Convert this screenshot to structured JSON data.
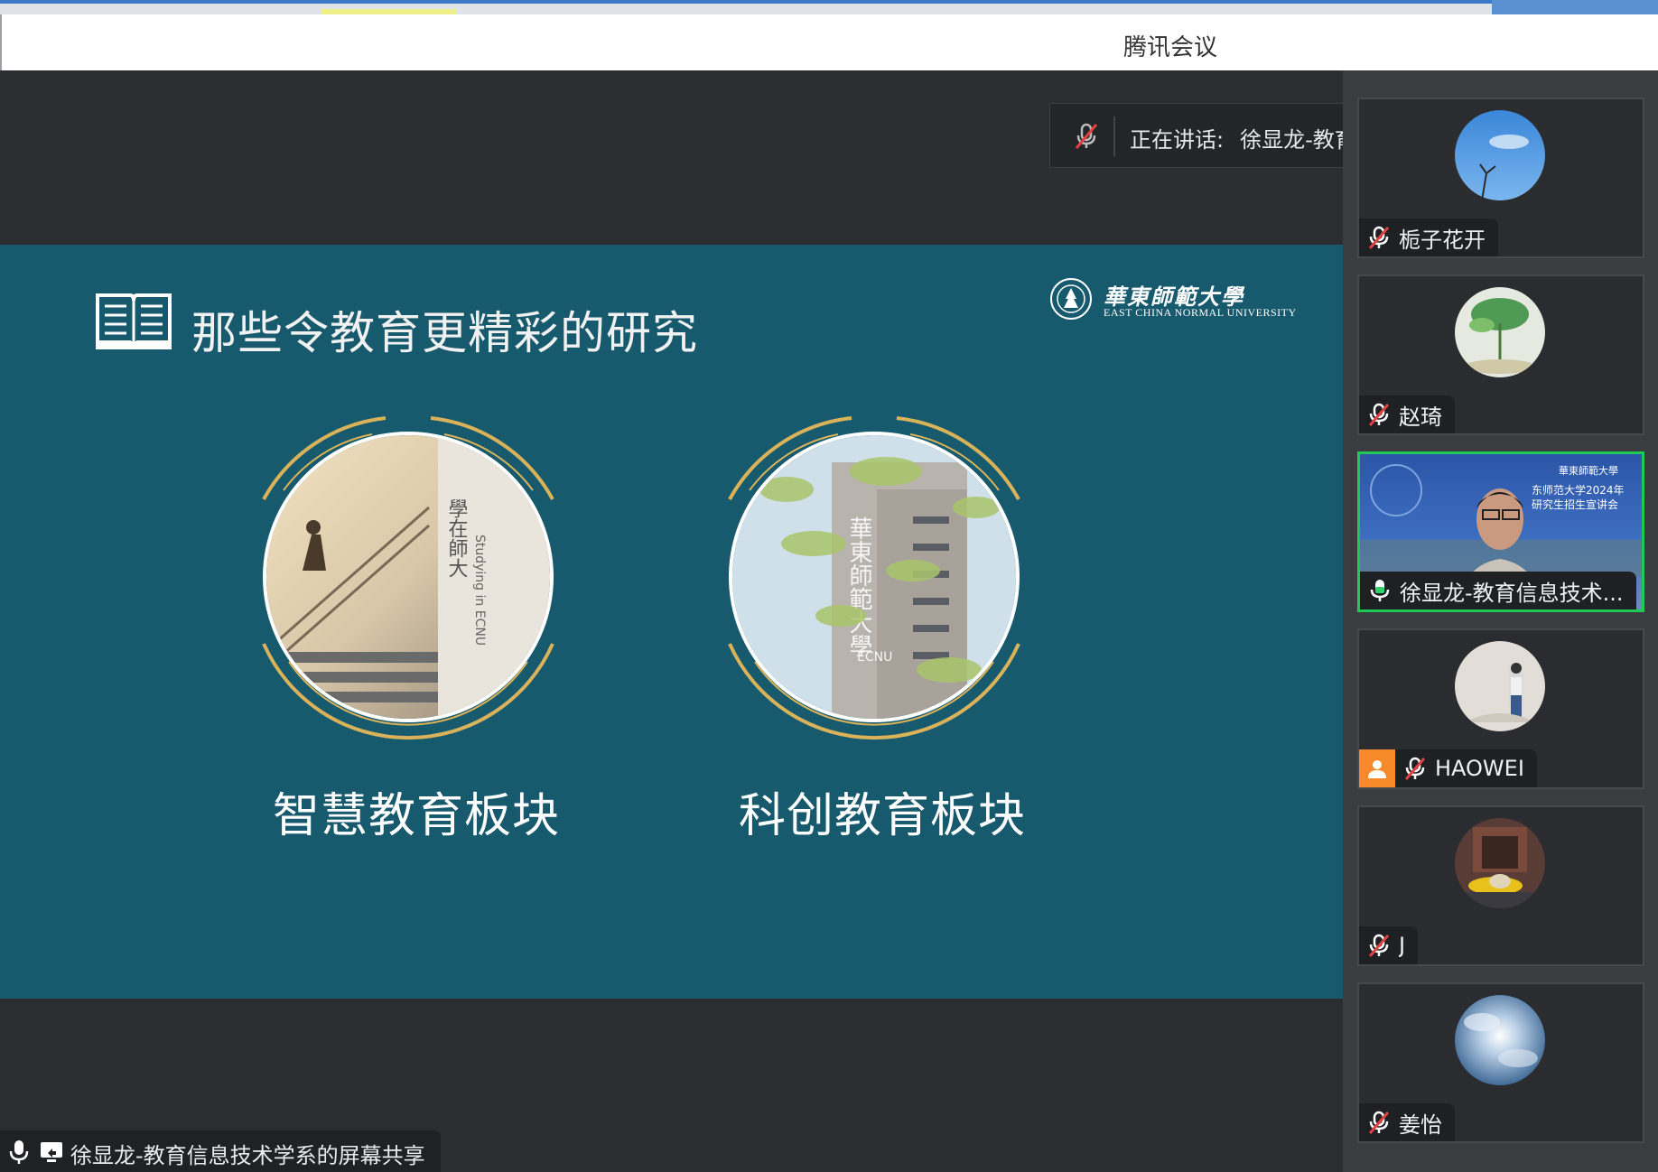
{
  "window": {
    "title": "腾讯会议"
  },
  "speaking": {
    "label": "正在讲话:",
    "name": "徐显龙-教育信息技..."
  },
  "slide": {
    "heading": "那些令教育更精彩的研究",
    "logo_cn": "華東師範大學",
    "logo_en": "EAST CHINA NORMAL UNIVERSITY",
    "modules": [
      {
        "label": "智慧教育板块",
        "photo_text_cn": "學在師大",
        "photo_text_en": "Studying in ECNU"
      },
      {
        "label": "科创教育板块",
        "photo_text_cn": "華東師範大學",
        "photo_text_en": "ECNU"
      }
    ]
  },
  "share": {
    "label": "徐显龙-教育信息技术学系的屏幕共享"
  },
  "participants": [
    {
      "name": "栀子花开",
      "muted": true
    },
    {
      "name": "赵琦",
      "muted": true
    },
    {
      "name": "徐显龙-教育信息技术...",
      "muted": false,
      "video_text": [
        "華東師範大學",
        "东师范大学2024年",
        "研究生招生宣讲会"
      ]
    },
    {
      "name": "HAOWEI",
      "muted": true
    },
    {
      "name": "J",
      "muted": true
    },
    {
      "name": "姜怡",
      "muted": true
    }
  ],
  "colors": {
    "slide_bg": "#175a6d",
    "ring_gold": "#d9b25a",
    "active_border": "#1fc955",
    "orange": "#f58a2a"
  }
}
